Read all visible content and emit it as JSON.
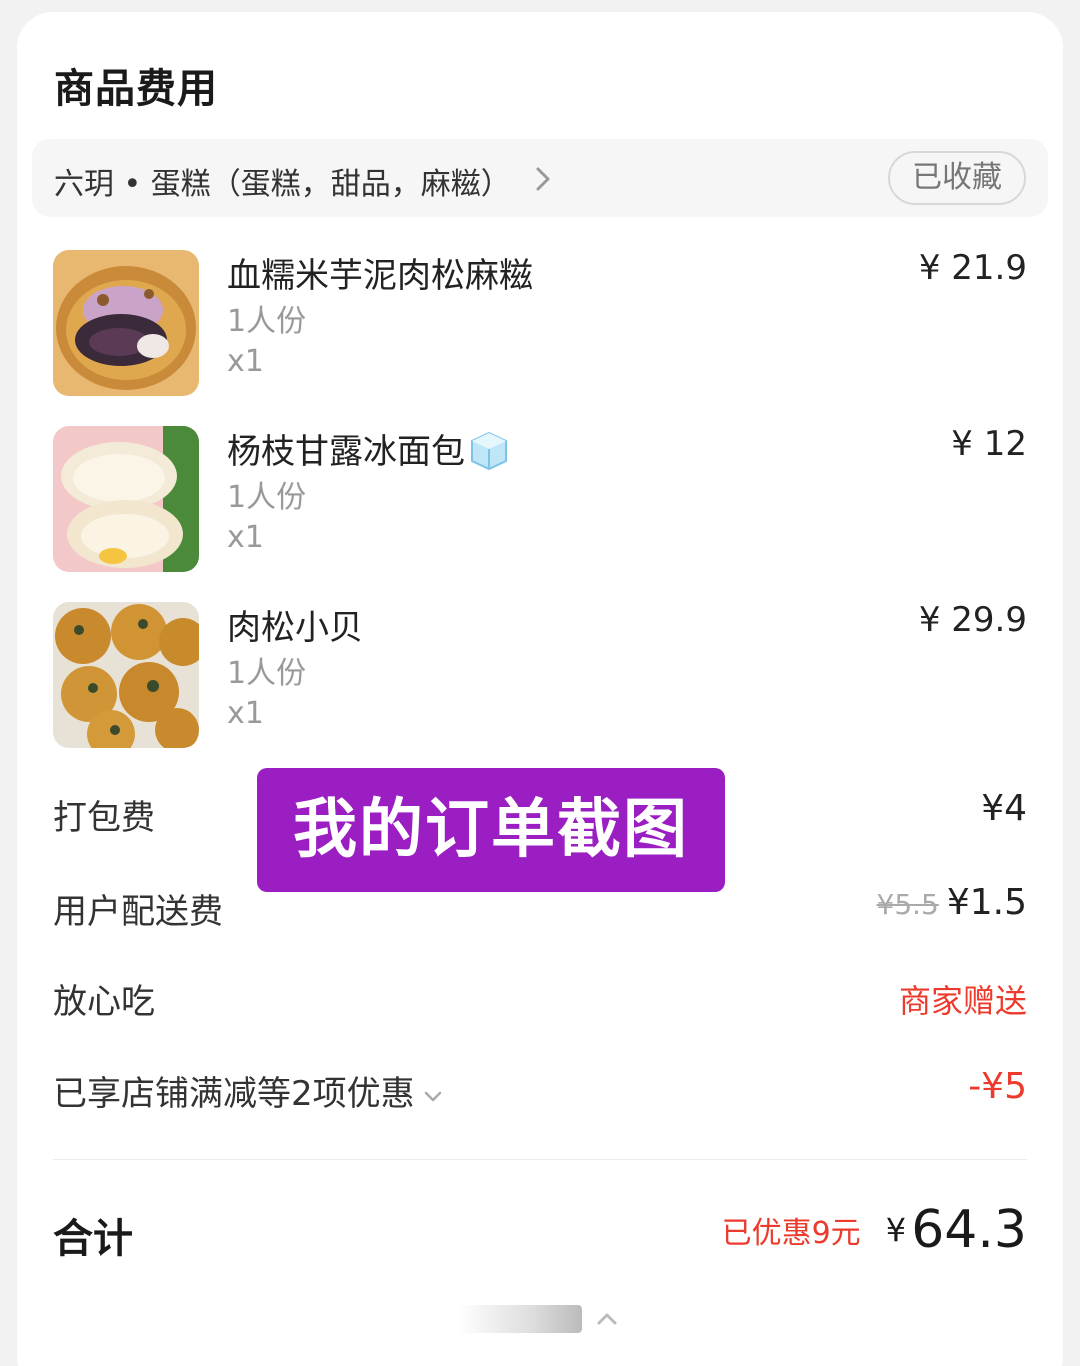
{
  "section": {
    "title": "商品费用"
  },
  "shop": {
    "name": "六玥 • 蛋糕（蛋糕，甜品，麻糍）",
    "favorite_label": "已收藏"
  },
  "items": [
    {
      "name": "血糯米芋泥肉松麻糍",
      "portion": "1人份",
      "quantity": "x1",
      "price": "¥ 21.9",
      "image": "taro-mochi-photo"
    },
    {
      "name": "杨枝甘露冰面包",
      "portion": "1人份",
      "quantity": "x1",
      "price": "¥ 12",
      "image": "mango-bread-photo",
      "badge_icon": "ice-cube-icon"
    },
    {
      "name": "肉松小贝",
      "portion": "1人份",
      "quantity": "x1",
      "price": "¥ 29.9",
      "image": "pork-floss-cake-photo"
    }
  ],
  "fees": {
    "packing": {
      "label": "打包费",
      "value": "¥4"
    },
    "delivery": {
      "label": "用户配送费",
      "original": "¥5.5",
      "value": "¥1.5"
    },
    "assurance": {
      "label": "放心吃",
      "value": "商家赠送"
    },
    "discounts": {
      "label": "已享店铺满减等2项优惠",
      "value": "-¥5"
    }
  },
  "total": {
    "label": "合计",
    "saved": "已优惠9元",
    "currency": "¥",
    "amount": "64.3"
  },
  "overlay": {
    "text": "我的订单截图"
  },
  "colors": {
    "accent_red": "#ec3b2c",
    "overlay_purple": "#9a1ec2"
  }
}
